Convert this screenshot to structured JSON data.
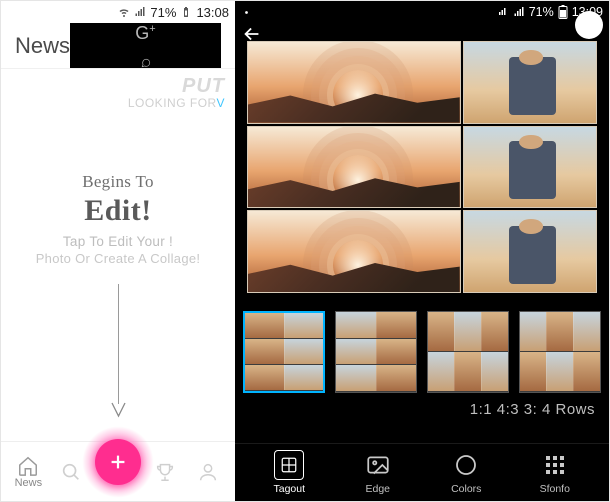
{
  "left": {
    "status": {
      "battery_pct": "71%",
      "time": "13:08"
    },
    "header": {
      "title": "News"
    },
    "watermark": {
      "line1": "PUT",
      "line2_prefix": "LOOKING FOR",
      "line2_accent": "V"
    },
    "hero": {
      "line1": "Begins To",
      "line2": "Edit!",
      "line3": "Tap To Edit Your !",
      "line4": "Photo Or Create A Collage!"
    },
    "nav": {
      "items": [
        {
          "label": "News",
          "icon": "home-icon"
        },
        {
          "label": "",
          "icon": "search-icon"
        },
        {
          "label": "",
          "icon": "plus-icon"
        },
        {
          "label": "",
          "icon": "trophy-icon"
        },
        {
          "label": "",
          "icon": "profile-icon"
        }
      ]
    }
  },
  "right": {
    "status": {
      "battery_pct": "71%",
      "time": "13:09"
    },
    "ratios": "1:1 4:3 3: 4 Rows",
    "toolbar": {
      "items": [
        {
          "label": "Tagout",
          "icon": "layout-icon"
        },
        {
          "label": "Edge",
          "icon": "image-icon"
        },
        {
          "label": "Colors",
          "icon": "circle-icon"
        },
        {
          "label": "Sfonfo",
          "icon": "pattern-icon"
        }
      ]
    }
  },
  "colors": {
    "accent_pink": "#ff2d8f",
    "accent_blue": "#00b4ff"
  }
}
